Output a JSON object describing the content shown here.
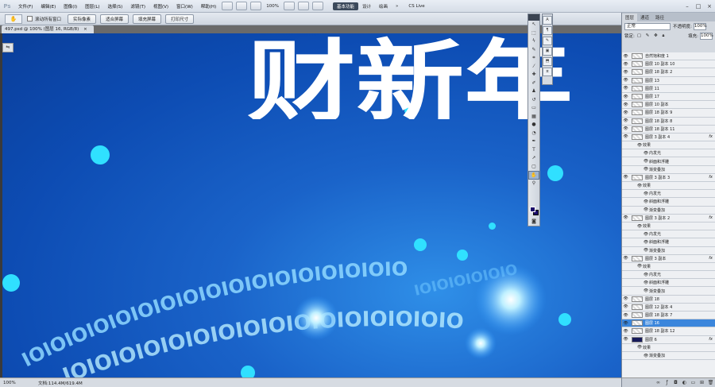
{
  "app": {
    "logo": "Ps"
  },
  "menu": [
    "文件(F)",
    "编辑(E)",
    "图像(I)",
    "图层(L)",
    "选择(S)",
    "滤镜(T)",
    "视图(V)",
    "窗口(W)",
    "帮助(H)"
  ],
  "menubar": {
    "zoom": "100%",
    "workspace_active": "基本功能",
    "workspaces": [
      "设计",
      "绘画"
    ],
    "overflow": "»",
    "cs_live": "CS Live"
  },
  "options": {
    "scroll_all_label": "滚动所有窗口",
    "buttons": [
      "实际像素",
      "适合屏幕",
      "填充屏幕",
      "打印尺寸"
    ]
  },
  "document": {
    "tab_title": "497.psd @ 100% (图层 16, RGB/8)",
    "close": "×"
  },
  "status": {
    "zoom": "100%",
    "doc_info": "文档:114.4M/619.4M"
  },
  "canvas": {
    "title_text": "财新年"
  },
  "layers_panel": {
    "tabs": [
      "图层",
      "通道",
      "路径"
    ],
    "blend_mode": "正常",
    "opacity_label": "不透明度:",
    "opacity_value": "100%",
    "lock_label": "锁定:",
    "fill_label": "填充:",
    "fill_value": "100%",
    "layers": [
      {
        "name": "自然饱和度 1",
        "thumb": "adj",
        "fx": false,
        "selected": false,
        "effect": false
      },
      {
        "name": "图层 10 副本 10",
        "thumb": "t",
        "fx": false,
        "selected": false,
        "effect": false
      },
      {
        "name": "图层 18 副本 2",
        "thumb": "t",
        "fx": false,
        "selected": false,
        "effect": false
      },
      {
        "name": "图层 13",
        "thumb": "t",
        "fx": false,
        "selected": false,
        "effect": false
      },
      {
        "name": "图层 11",
        "thumb": "t",
        "fx": false,
        "selected": false,
        "effect": false
      },
      {
        "name": "图层 17",
        "thumb": "t",
        "fx": false,
        "selected": false,
        "effect": false
      },
      {
        "name": "图层 10 副本",
        "thumb": "t",
        "fx": false,
        "selected": false,
        "effect": false
      },
      {
        "name": "图层 18 副本 9",
        "thumb": "t",
        "fx": false,
        "selected": false,
        "effect": false
      },
      {
        "name": "图层 18 副本 8",
        "thumb": "t",
        "fx": false,
        "selected": false,
        "effect": false
      },
      {
        "name": "图层 18 副本 11",
        "thumb": "t",
        "fx": false,
        "selected": false,
        "effect": false
      },
      {
        "name": "图层 3 副本 4",
        "thumb": "t",
        "fx": true,
        "selected": false,
        "effect": false
      },
      {
        "name": "效果",
        "effect": true
      },
      {
        "name": "内发光",
        "effect": true,
        "sub": true
      },
      {
        "name": "斜面和浮雕",
        "effect": true,
        "sub": true
      },
      {
        "name": "渐变叠加",
        "effect": true,
        "sub": true
      },
      {
        "name": "图层 3 副本 3",
        "thumb": "t",
        "fx": true,
        "selected": false,
        "effect": false
      },
      {
        "name": "效果",
        "effect": true
      },
      {
        "name": "内发光",
        "effect": true,
        "sub": true
      },
      {
        "name": "斜面和浮雕",
        "effect": true,
        "sub": true
      },
      {
        "name": "渐变叠加",
        "effect": true,
        "sub": true
      },
      {
        "name": "图层 3 副本 2",
        "thumb": "t",
        "fx": true,
        "selected": false,
        "effect": false
      },
      {
        "name": "效果",
        "effect": true
      },
      {
        "name": "内发光",
        "effect": true,
        "sub": true
      },
      {
        "name": "斜面和浮雕",
        "effect": true,
        "sub": true
      },
      {
        "name": "渐变叠加",
        "effect": true,
        "sub": true
      },
      {
        "name": "图层 3 副本",
        "thumb": "t",
        "fx": true,
        "selected": false,
        "effect": false
      },
      {
        "name": "效果",
        "effect": true
      },
      {
        "name": "内发光",
        "effect": true,
        "sub": true
      },
      {
        "name": "斜面和浮雕",
        "effect": true,
        "sub": true
      },
      {
        "name": "渐变叠加",
        "effect": true,
        "sub": true
      },
      {
        "name": "图层 18",
        "thumb": "t",
        "fx": false,
        "selected": false,
        "effect": false
      },
      {
        "name": "图层 12 副本 4",
        "thumb": "t",
        "fx": false,
        "selected": false,
        "effect": false
      },
      {
        "name": "图层 18 副本 7",
        "thumb": "t",
        "fx": false,
        "selected": false,
        "effect": false
      },
      {
        "name": "图层 16",
        "thumb": "t",
        "fx": false,
        "selected": true,
        "effect": false
      },
      {
        "name": "图层 18 副本 12",
        "thumb": "t",
        "fx": false,
        "selected": false,
        "effect": false
      },
      {
        "name": "图层 6",
        "thumb": "dark",
        "fx": true,
        "selected": false,
        "effect": false
      },
      {
        "name": "效果",
        "effect": true
      },
      {
        "name": "渐变叠加",
        "effect": true,
        "sub": true
      }
    ]
  },
  "colors": {
    "foreground": "#1a0a6a",
    "background": "#1a0a6a",
    "selected_row": "#3b86dc",
    "canvas_blue": "#0d4cb3"
  }
}
